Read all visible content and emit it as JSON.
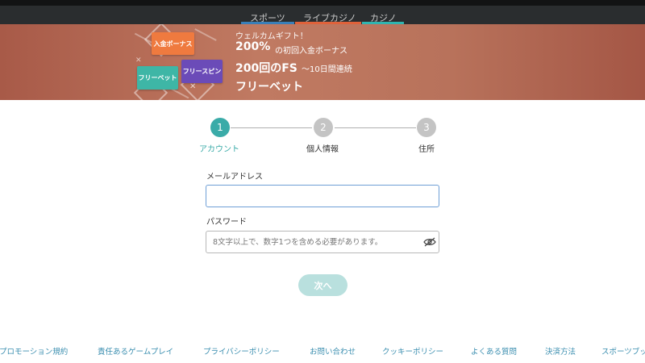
{
  "nav": {
    "tabs": [
      {
        "label": "スポーツ",
        "underline": "#3a7fb8"
      },
      {
        "label": "ライブカジノ",
        "underline": "#e0623a"
      },
      {
        "label": "カジノ",
        "underline": "#2fb5b0",
        "active": true
      }
    ]
  },
  "banner": {
    "badges": {
      "deposit": "入金ボーナス",
      "freespin": "フリースピン",
      "freebet": "フリーベット"
    },
    "welcome": "ウェルカムギフト！",
    "percent": "200%",
    "percent_text": "の初回入金ボーナス",
    "fs_main": "200回のFS",
    "fs_sub": "〜10日間連続",
    "freebet": "フリーベット"
  },
  "stepper": {
    "steps": [
      {
        "number": "1",
        "label": "アカウント",
        "active": true
      },
      {
        "number": "2",
        "label": "個人情報",
        "active": false
      },
      {
        "number": "3",
        "label": "住所",
        "active": false
      }
    ]
  },
  "form": {
    "email_label": "メールアドレス",
    "email_value": "",
    "password_label": "パスワード",
    "password_placeholder": "8文字以上で、数字1つを含める必要があります。",
    "next_label": "次へ"
  },
  "footer": {
    "links": [
      "プロモーション規約",
      "責任あるゲームプレイ",
      "プライバシーポリシー",
      "お問い合わせ",
      "クッキーポリシー",
      "よくある質問",
      "決済方法",
      "スポーツブック"
    ]
  },
  "colors": {
    "accent": "#3aaba8",
    "step_inactive": "#c4c4c4",
    "link": "#3c8fb0",
    "button_disabled": "#b9e0de",
    "topbar": "#2a2d2f"
  }
}
